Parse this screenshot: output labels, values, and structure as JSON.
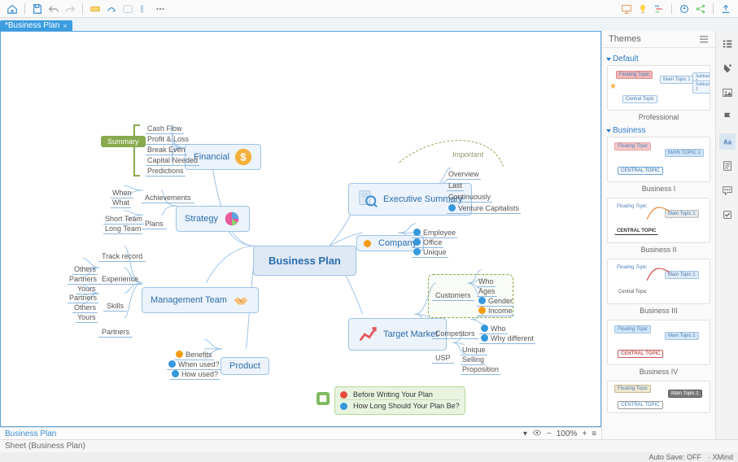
{
  "toolbar": {
    "icons": [
      "home",
      "save",
      "undo",
      "redo",
      "topic",
      "relationship",
      "boundary",
      "brackets",
      "more"
    ],
    "rightIcons": [
      "slide",
      "idea",
      "gantt",
      "sync",
      "share",
      "export"
    ]
  },
  "tab": {
    "title": "*Business Plan",
    "close": "×"
  },
  "canvas": {
    "central": "Business Plan",
    "topics": {
      "financial": {
        "label": "Financial",
        "leaves": [
          "Cash Flow",
          "Profit & Loss",
          "Break Even",
          "Capital Needed",
          "Predictions"
        ],
        "summary": "Summary"
      },
      "strategy": {
        "label": "Strategy",
        "groups": [
          {
            "label": "Achievements",
            "leaves": [
              "When",
              "What"
            ]
          },
          {
            "label": "Plans",
            "leaves": [
              "Short Team",
              "Long Team"
            ]
          }
        ]
      },
      "management": {
        "label": "Management Team",
        "groups": [
          {
            "label": "Track record",
            "leaves": []
          },
          {
            "label": "Experience",
            "leaves": [
              "Others",
              "Partners",
              "Yours"
            ]
          },
          {
            "label": "Skills",
            "leaves": [
              "Partners",
              "Others",
              "Yours"
            ]
          },
          {
            "label": "Partners",
            "leaves": []
          }
        ]
      },
      "product": {
        "label": "Product",
        "leaves": [
          {
            "marker": "orange",
            "text": "Benefits"
          },
          {
            "marker": "blue",
            "text": "When used?"
          },
          {
            "marker": "blue",
            "text": "How used?"
          }
        ]
      },
      "exec": {
        "label": "Executive Summary",
        "leaves": [
          "Overview",
          "Last",
          "Continuously",
          {
            "marker": "blue",
            "text": "Venture Capitalists"
          }
        ],
        "callout": "Important"
      },
      "company": {
        "label": "Company",
        "leaves": [
          {
            "marker": "blue",
            "text": "Employee"
          },
          {
            "marker": "blue",
            "text": "Office"
          },
          {
            "marker": "blue",
            "text": "Unique"
          }
        ]
      },
      "target": {
        "label": "Target Market",
        "groups": [
          {
            "label": "Customers",
            "leaves": [
              "Who",
              "Ages",
              {
                "marker": "blue",
                "text": "Gender"
              },
              {
                "marker": "orange",
                "text": "Income"
              }
            ]
          },
          {
            "label": "Competitors",
            "leaves": [
              {
                "marker": "blue",
                "text": "Who"
              },
              {
                "marker": "blue",
                "text": "Why different"
              }
            ]
          },
          {
            "label": "USP",
            "leaves": [
              "Unique",
              "Selling",
              "Proposition"
            ]
          }
        ]
      }
    },
    "notes": [
      {
        "marker": "red",
        "text": "Before Writing Your Plan"
      },
      {
        "marker": "blue",
        "text": "How Long Should Your Plan Be?"
      }
    ]
  },
  "strip": {
    "sheet": "Business Plan",
    "zoom": "100%"
  },
  "panel": {
    "title": "Themes",
    "sections": [
      {
        "label": "Default",
        "themes": [
          {
            "name": "Professional",
            "center": "Central Topic"
          }
        ]
      },
      {
        "label": "Business",
        "themes": [
          {
            "name": "Business I",
            "center": "CENTRAL TOPIC"
          },
          {
            "name": "Business II",
            "center": "CENTRAL TOPIC"
          },
          {
            "name": "Business III",
            "center": "Central Topic"
          },
          {
            "name": "Business IV",
            "center": "CENTRAL TOPIC"
          },
          {
            "name": "",
            "center": "CENTRAL TOPIC"
          }
        ]
      }
    ]
  },
  "rail": [
    "outline",
    "marker",
    "image",
    "flag",
    "aa",
    "notes",
    "comments",
    "task"
  ],
  "sheet": {
    "label": "Sheet (Business Plan)"
  },
  "status": {
    "autosave": "Auto Save: OFF",
    "brand": "· XMind"
  }
}
